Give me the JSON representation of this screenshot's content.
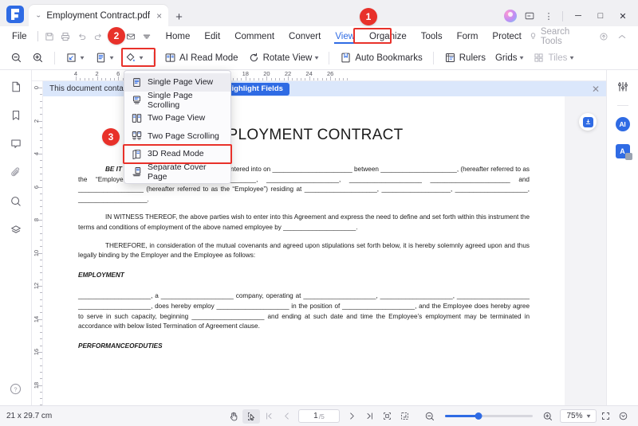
{
  "titlebar": {
    "tab_name": "Employment Contract.pdf",
    "tab_collapse_icon": "chevron-double-down-icon",
    "tab_close": "×",
    "new_tab": "+",
    "comment_icon": "message-icon",
    "more_icon": "⋮",
    "minimize": "─",
    "maximize": "□",
    "close": "✕"
  },
  "menubar": {
    "file": "File",
    "items": [
      {
        "label": "Home",
        "active": false
      },
      {
        "label": "Edit",
        "active": false
      },
      {
        "label": "Comment",
        "active": false
      },
      {
        "label": "Convert",
        "active": false
      },
      {
        "label": "View",
        "active": true
      },
      {
        "label": "Organize",
        "active": false
      },
      {
        "label": "Tools",
        "active": false
      },
      {
        "label": "Form",
        "active": false
      },
      {
        "label": "Protect",
        "active": false
      }
    ],
    "search_tools": "Search Tools",
    "search_icon": "lightbulb-icon",
    "upload_icon": "cloud-upload-icon",
    "collapse_ribbon_icon": "chevron-up-icon",
    "quick_access": [
      {
        "name": "save-icon"
      },
      {
        "name": "print-icon"
      },
      {
        "name": "undo-icon"
      },
      {
        "name": "redo-icon"
      },
      {
        "name": "share-icon"
      },
      {
        "name": "email-icon"
      },
      {
        "name": "customize-caret-icon"
      }
    ]
  },
  "ribbon": {
    "zoom_out": "zoom-out-icon",
    "zoom_in": "zoom-in-icon",
    "fit_page": "fit-page-icon",
    "page_view": "page-view-icon",
    "background_color": "paint-bucket-icon",
    "ai_read_mode": "AI Read Mode",
    "rotate_view": "Rotate View",
    "auto_bookmarks": "Auto Bookmarks",
    "rulers": "Rulers",
    "grids": "Grids",
    "tiles": "Tiles"
  },
  "view_dropdown": {
    "items": [
      {
        "label": "Single Page View",
        "icon": "single-page-icon",
        "selected": true,
        "highlighted": false
      },
      {
        "label": "Single Page Scrolling",
        "icon": "single-page-scroll-icon",
        "selected": false,
        "highlighted": false
      },
      {
        "label": "Two Page View",
        "icon": "two-page-icon",
        "selected": false,
        "highlighted": false
      },
      {
        "label": "Two Page Scrolling",
        "icon": "two-page-scroll-icon",
        "selected": false,
        "highlighted": false
      },
      {
        "label": "3D Read Mode",
        "icon": "three-d-read-icon",
        "selected": false,
        "highlighted": true
      },
      {
        "label": "Separate Cover Page",
        "icon": "cover-page-icon",
        "selected": false,
        "highlighted": false
      }
    ]
  },
  "callouts": [
    {
      "number": "1",
      "target": "view-menu-tab"
    },
    {
      "number": "2",
      "target": "page-view-ribbon-button"
    },
    {
      "number": "3",
      "target": "3d-read-mode-menu-item"
    }
  ],
  "left_sidebar": {
    "items": [
      {
        "name": "thumbnails-icon"
      },
      {
        "name": "bookmarks-icon"
      },
      {
        "name": "comments-icon"
      },
      {
        "name": "attachments-icon"
      },
      {
        "name": "search-icon"
      },
      {
        "name": "layers-icon"
      }
    ],
    "help": "?"
  },
  "right_sidebar": {
    "items": [
      {
        "name": "adjust-sliders-icon",
        "label": ""
      },
      {
        "name": "ai-assistant-icon",
        "label": "AI"
      },
      {
        "name": "translate-icon",
        "label": "A"
      }
    ]
  },
  "form_bar": {
    "message": "This document contains interactive form fields.",
    "button": "Highlight Fields",
    "close": "✕"
  },
  "rulers": {
    "horizontal_ticks": [
      "4",
      "2",
      "",
      "2",
      "4",
      "6",
      "8",
      "10",
      "12",
      "14",
      "16",
      "18",
      "20",
      "22",
      "24",
      "26"
    ],
    "horizontal_labels": [
      "4",
      "2",
      "6",
      "8",
      "10",
      "12",
      "14",
      "16",
      "18",
      "20",
      "22",
      "24",
      "26"
    ],
    "vertical_labels": [
      "0",
      "2",
      "4",
      "6",
      "8",
      "10",
      "12",
      "14",
      "16",
      "18"
    ]
  },
  "document": {
    "title": "EMPLOYMENT CONTRACT",
    "download_icon": "download-icon",
    "paragraphs": [
      {
        "id": "p-be-it-known",
        "lead": "BE IT KNOWN",
        "text": ", that this AGREEMENT is entered into on ______________________ between _____________________, (hereafter referred to as the “Employer”), located at ____________________, ____________________, ____________________ ______________________ and __________________ (hereafter referred to as the “Employee”) residing at ____________________, ___________________, ____________________, ___________________."
      },
      {
        "id": "p-in-witness",
        "lead": "IN WITNESS THEREOF",
        "text": ", the above parties wish to enter into this Agreement and express the need to define and set forth within this instrument the terms and conditions of employment of the above named employee by ____________________."
      },
      {
        "id": "p-therefore",
        "lead": "THEREFORE,",
        "text": " in consideration of the mutual covenants and agreed upon stipulations set forth below, it is hereby solemnly agreed upon and thus legally binding by the Employer and the Employee as follows:"
      }
    ],
    "heading_employment": "EMPLOYMENT",
    "employment_body": "____________________, a ____________________ company, operating at ____________________, ____________________, ____________________ ____________________, does hereby employ ____________________ in the position of ____________________, and the Employee does hereby agree to serve in such capacity, beginning ____________________ and ending at such date and time the Employee’s employment may be terminated in accordance with below listed Termination of Agreement clause.",
    "heading_performance": "PERFORMANCEOFDUTIES"
  },
  "statusbar": {
    "page_size": "21 x 29.7 cm",
    "hand_tool": "hand-tool-icon",
    "select_tool": "select-tool-icon",
    "first_page": "first-page-icon",
    "prev_page": "previous-page-icon",
    "current_page": "1",
    "total_pages": "/5",
    "next_page": "next-page-icon",
    "last_page": "last-page-icon",
    "fit_width": "fit-width-icon",
    "fit_page": "fit-page-icon",
    "zoom_out": "zoom-out-icon",
    "zoom_in": "zoom-in-icon",
    "zoom_level": "75%",
    "zoom_caret": "⌄",
    "fullscreen": "fullscreen-icon",
    "more": "more-options-icon"
  },
  "colors": {
    "accent": "#2f6be4",
    "callout_red": "#e8312a",
    "form_bar_bg": "#dbe7fb",
    "chrome_bg": "#f0f0f3"
  }
}
